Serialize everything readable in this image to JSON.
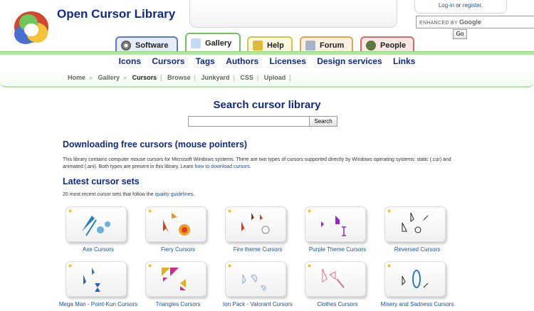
{
  "site": {
    "title": "Open Cursor Library"
  },
  "login": {
    "login_link": "Log-in",
    "or": "or",
    "register_link": "register."
  },
  "google_search": {
    "label": "ENHANCED BY",
    "brand": "Google",
    "go_label": "Go"
  },
  "tabs": [
    {
      "label": "Software",
      "color": "#5a79c8",
      "bg": "#e5ecfa"
    },
    {
      "label": "Gallery",
      "color": "#6cc35a",
      "bg": "#ffffff"
    },
    {
      "label": "Help",
      "color": "#d6c44a",
      "bg": "#fbf8df"
    },
    {
      "label": "Forum",
      "color": "#e6a24a",
      "bg": "#fdf1e2"
    },
    {
      "label": "People",
      "color": "#d86a6a",
      "bg": "#fbe6e6"
    }
  ],
  "subnav": [
    "Icons",
    "Cursors",
    "Tags",
    "Authors",
    "Licenses",
    "Design services",
    "Links"
  ],
  "breadcrumb": {
    "home": "Home",
    "gallery": "Gallery",
    "cursors": "Cursors",
    "browse": "Browse",
    "junkyard": "Junkyard",
    "css": "CSS",
    "upload": "Upload"
  },
  "search": {
    "title": "Search cursor library",
    "button": "Search"
  },
  "download": {
    "heading": "Downloading free cursors (mouse pointers)",
    "text": "This library contains computer mouse cursors for Microsoft Windows systems. There are two types of cursors supported directly by Windows operating systems: static (.cur) and animated (.ani). Both types are present in this library. Learn",
    "link": "how to download cursors",
    "end": "."
  },
  "latest": {
    "heading": "Latest cursor sets",
    "text": "20 most recent cursor sets that follow the",
    "link": "quality guidelines",
    "end": "."
  },
  "cursor_sets": [
    {
      "name": "Axe Cursors",
      "icon": "axe-cursor-icon"
    },
    {
      "name": "Fiery Cursors",
      "icon": "fiery-cursor-icon"
    },
    {
      "name": "Fire theme Cursors",
      "icon": "fire-theme-cursor-icon"
    },
    {
      "name": "Purple Theme Cursors",
      "icon": "purple-cursor-icon"
    },
    {
      "name": "Reversed Cursors",
      "icon": "reversed-cursor-icon"
    },
    {
      "name": "Mega Man - Point-Kun Cursors",
      "icon": "megaman-cursor-icon"
    },
    {
      "name": "Triangles Cursors",
      "icon": "triangle-cursor-icon"
    },
    {
      "name": "Ion Pack - Valorant Cursors",
      "icon": "ion-cursor-icon"
    },
    {
      "name": "Clothes Cursors",
      "icon": "clothes-cursor-icon"
    },
    {
      "name": "Misery and Sadness Cursors",
      "icon": "misery-cursor-icon"
    }
  ]
}
